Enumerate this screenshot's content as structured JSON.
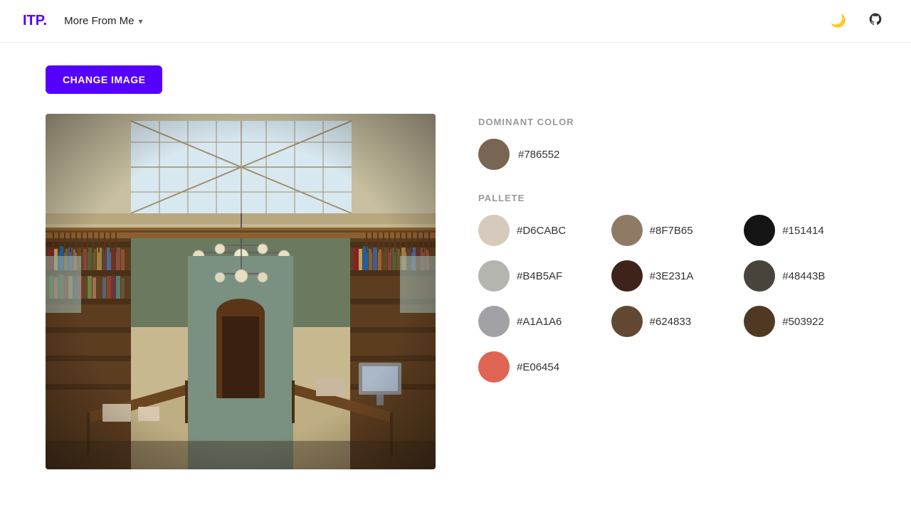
{
  "app": {
    "logo_text": "ITP",
    "logo_dot": ".",
    "accent_color": "#5500ff"
  },
  "navbar": {
    "more_from_me_label": "More From Me",
    "chevron": "▾"
  },
  "toolbar": {
    "change_image_label": "CHANGE IMAGE"
  },
  "dominant": {
    "section_label": "DOMINANT COLOR",
    "color": "#786552",
    "hex": "#786552"
  },
  "palette": {
    "section_label": "PALLETE",
    "items": [
      {
        "hex": "#D6CABC",
        "col": 0
      },
      {
        "hex": "#8F7B65",
        "col": 1
      },
      {
        "hex": "#151414",
        "col": 2
      },
      {
        "hex": "#B4B5AF",
        "col": 0
      },
      {
        "hex": "#3E231A",
        "col": 1
      },
      {
        "hex": "#48443B",
        "col": 2
      },
      {
        "hex": "#A1A1A6",
        "col": 0
      },
      {
        "hex": "#624833",
        "col": 1
      },
      {
        "hex": "#503922",
        "col": 2
      },
      {
        "hex": "#E06454",
        "col": 0
      }
    ]
  }
}
